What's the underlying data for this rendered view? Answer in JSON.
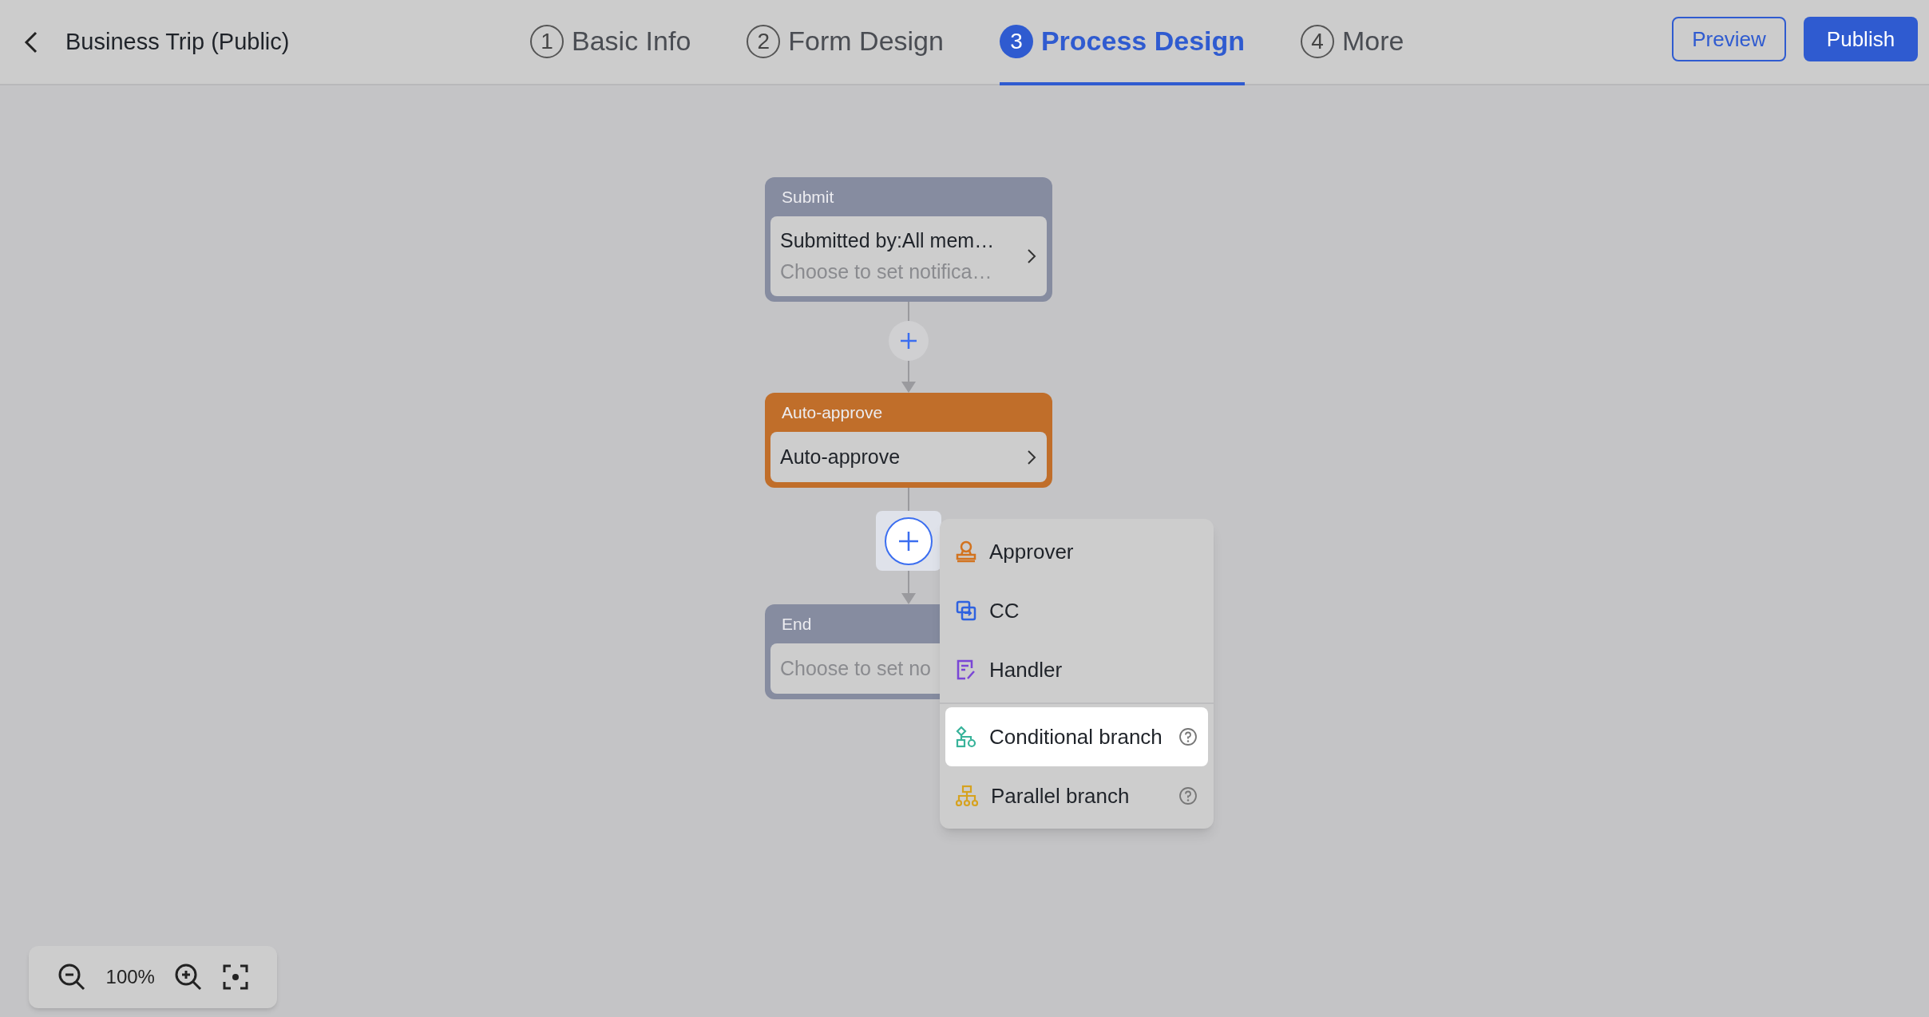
{
  "header": {
    "title": "Business Trip (Public)"
  },
  "steps": [
    {
      "number": "1",
      "label": "Basic Info",
      "selected": false
    },
    {
      "number": "2",
      "label": "Form Design",
      "selected": false
    },
    {
      "number": "3",
      "label": "Process Design",
      "selected": true
    },
    {
      "number": "4",
      "label": "More",
      "selected": false
    }
  ],
  "buttons": [
    {
      "label": "Preview",
      "kind": "outline"
    },
    {
      "label": "Publish",
      "kind": "primary"
    }
  ],
  "nodes": [
    {
      "kind": "submit",
      "title": "Submit",
      "line_1": "Submitted by:All mem…",
      "line_2": "Choose to set notifica…",
      "chevron": true
    },
    {
      "kind": "auto",
      "title": "Auto-approve",
      "line_1": "Auto-approve",
      "chevron": true
    },
    {
      "kind": "end",
      "title": "End",
      "line_2": "Choose to set no"
    }
  ],
  "add_menu": {
    "sections": [
      [
        {
          "kind": "approver",
          "label": "Approver",
          "selected": false,
          "help": false
        },
        {
          "kind": "cc",
          "label": "CC",
          "selected": false,
          "help": false
        },
        {
          "kind": "handler",
          "label": "Handler",
          "selected": false,
          "help": false
        }
      ],
      [
        {
          "kind": "conditional",
          "label": "Conditional branch",
          "selected": true,
          "help": true
        },
        {
          "kind": "parallel",
          "label": "Parallel branch",
          "selected": false,
          "help": true
        }
      ]
    ]
  },
  "zoom_controls": {
    "level": "100%"
  }
}
